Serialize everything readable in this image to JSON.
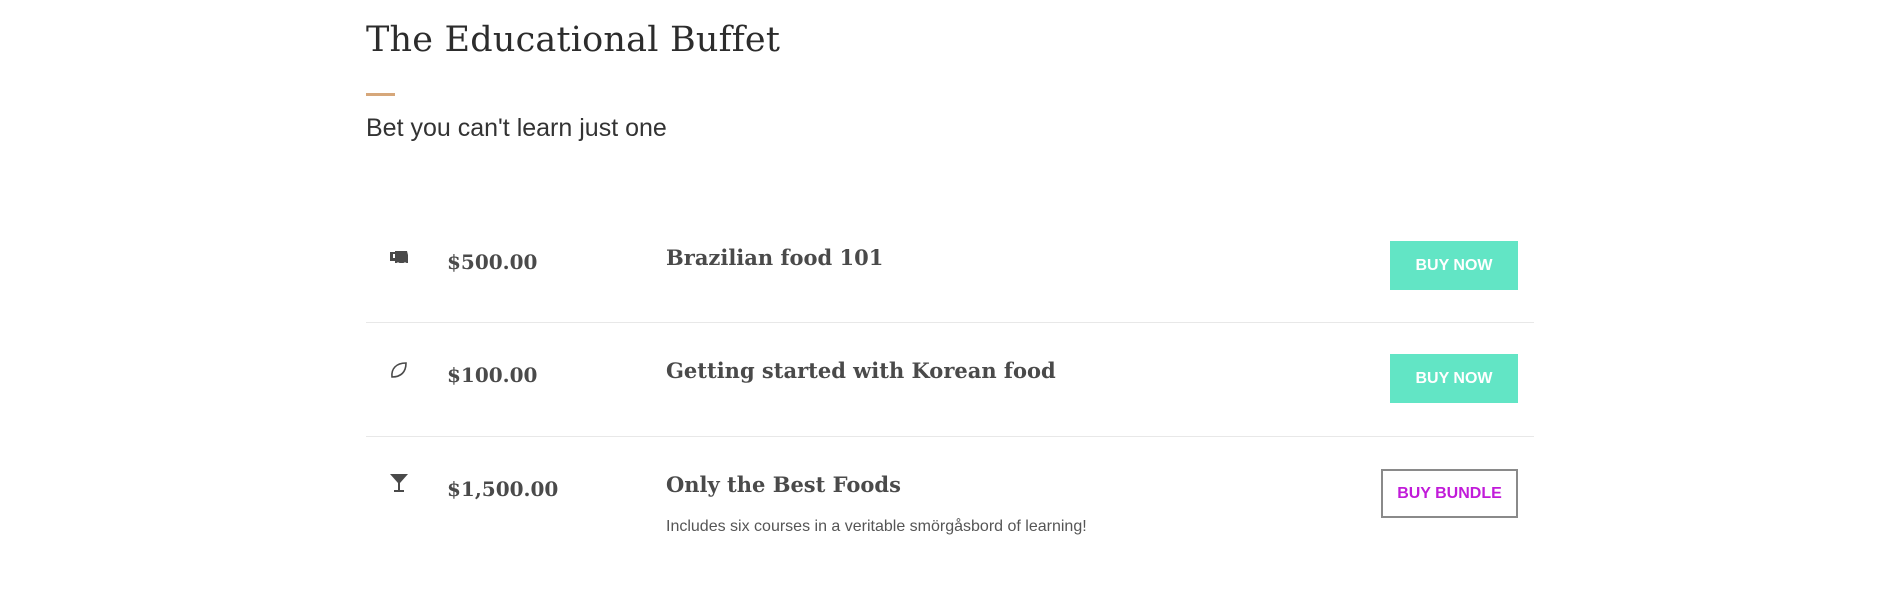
{
  "header": {
    "title": "The Educational Buffet",
    "subtitle": "Bet you can't learn just one",
    "rule_color": "#d6a77a"
  },
  "offers": [
    {
      "icon": "food-truck-icon",
      "price": "$500.00",
      "name": "Brazilian food 101",
      "description": "",
      "button_label": "BUY NOW"
    },
    {
      "icon": "leaf-icon",
      "price": "$100.00",
      "name": "Getting started with Korean food",
      "description": "",
      "button_label": "BUY NOW"
    },
    {
      "icon": "cocktail-glass-icon",
      "price": "$1,500.00",
      "name": "Only the Best Foods",
      "description": "Includes six courses in a veritable smörgåsbord of learning!",
      "button_label": "BUY BUNDLE"
    }
  ],
  "colors": {
    "buy_button_bg": "#62e5c5",
    "bundle_button_text": "#c11bd9"
  }
}
